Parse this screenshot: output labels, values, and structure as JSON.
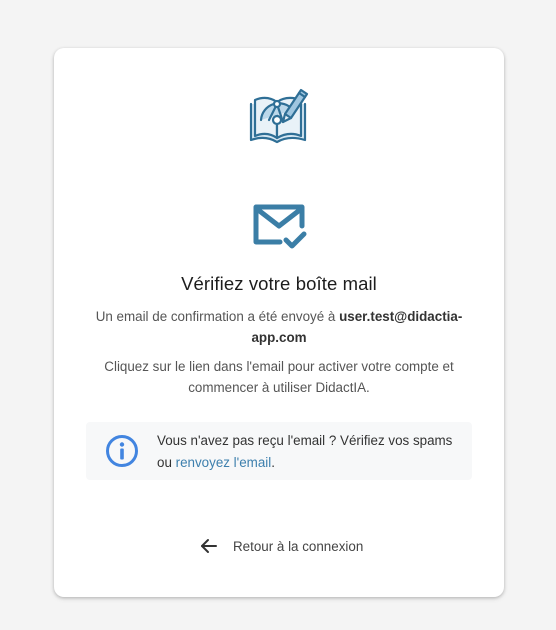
{
  "card": {
    "logo": {
      "icon": "book-compass-pencil-logo-icon"
    },
    "mail": {
      "icon": "mail-check-icon"
    },
    "title": "Vérifiez votre boîte mail",
    "sent_prefix": "Un email de confirmation a été envoyé à ",
    "email": "user.test@didactia-app.com",
    "instructions": "Cliquez sur le lien dans l'email pour activer votre compte et commencer à utiliser DidactIA.",
    "info": {
      "icon": "info-icon",
      "text_before": "Vous n'avez pas reçu l'email ? Vérifiez vos spams ou ",
      "resend_link": "renvoyez l'email",
      "text_after": "."
    },
    "back": {
      "icon": "arrow-left-icon",
      "label": "Retour à la connexion"
    }
  },
  "colors": {
    "icon_blue": "#3b7ea6",
    "info_blue": "#4285e0",
    "link": "#3d7fad",
    "background": "#f4f4f4",
    "card": "#ffffff"
  }
}
